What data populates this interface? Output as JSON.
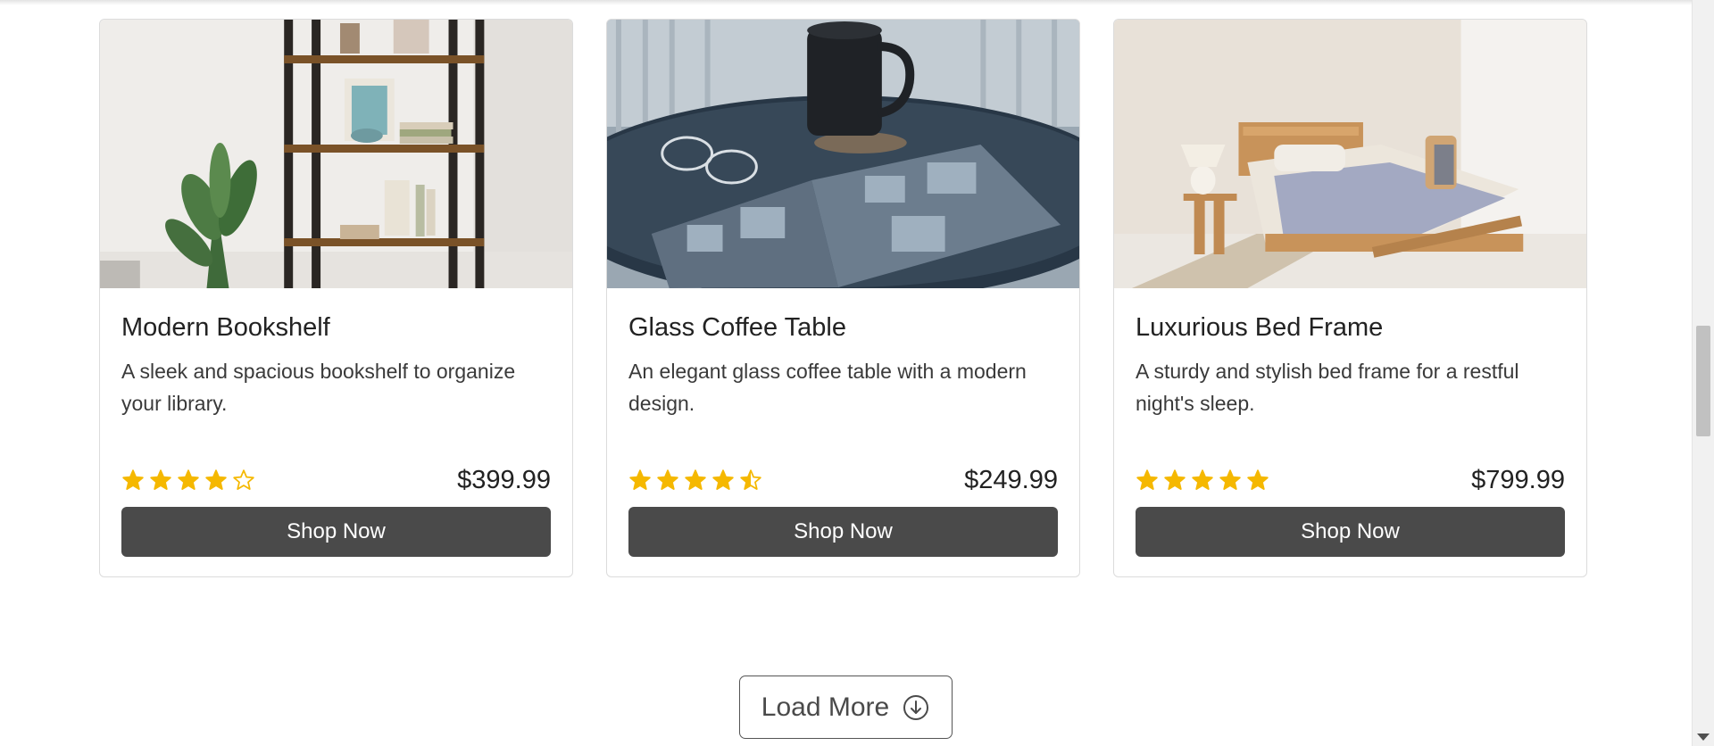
{
  "products": [
    {
      "id": "modern-bookshelf",
      "title": "Modern Bookshelf",
      "description": "A sleek and spacious bookshelf to organize your library.",
      "rating": 4,
      "max_rating": 5,
      "price": "$399.99",
      "button_label": "Shop Now"
    },
    {
      "id": "glass-coffee-table",
      "title": "Glass Coffee Table",
      "description": "An elegant glass coffee table with a modern design.",
      "rating": 4.5,
      "max_rating": 5,
      "price": "$249.99",
      "button_label": "Shop Now"
    },
    {
      "id": "luxurious-bed-frame",
      "title": "Luxurious Bed Frame",
      "description": "A sturdy and stylish bed frame for a restful night's sleep.",
      "rating": 5,
      "max_rating": 5,
      "price": "$799.99",
      "button_label": "Shop Now"
    }
  ],
  "load_more": {
    "label": "Load More",
    "icon": "arrow-down-circle-icon"
  },
  "colors": {
    "star": "#f5b800",
    "button_bg": "#4a4a4a",
    "button_text": "#ffffff",
    "card_border": "#dcdcdc"
  }
}
